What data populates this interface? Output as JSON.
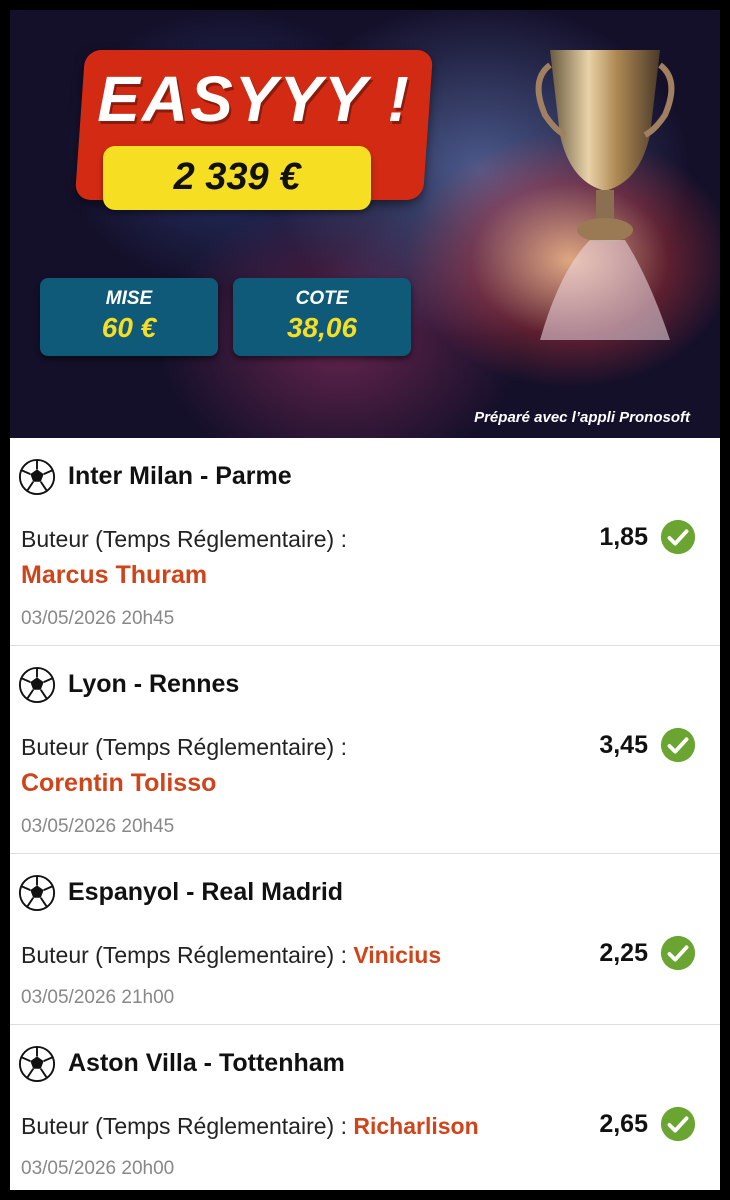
{
  "hero": {
    "headline": "EASYYY !",
    "amount": "2 339 €",
    "stake_label": "MISE",
    "stake_value": "60 €",
    "odds_label": "COTE",
    "odds_value": "38,06",
    "credit": "Préparé avec l’appli Pronosoft"
  },
  "bets": [
    {
      "match": "Inter Milan - Parme",
      "market": "Buteur (Temps Réglementaire) :",
      "player": "Marcus Thuram",
      "odds": "1,85",
      "date": "03/05/2026 20h45",
      "status": "won"
    },
    {
      "match": "Lyon - Rennes",
      "market": "Buteur (Temps Réglementaire) :",
      "player": "Corentin Tolisso",
      "odds": "3,45",
      "date": "03/05/2026 20h45",
      "status": "won"
    },
    {
      "match": "Espanyol - Real Madrid",
      "market": "Buteur (Temps Réglementaire) :",
      "player": "Vinicius",
      "odds": "2,25",
      "date": "03/05/2026 21h00",
      "status": "won"
    },
    {
      "match": "Aston Villa - Tottenham",
      "market": "Buteur (Temps Réglementaire) :",
      "player": "Richarlison",
      "odds": "2,65",
      "date": "03/05/2026 20h00",
      "status": "won"
    }
  ],
  "icons": {
    "sport": "soccer-ball-icon",
    "status": "check-circle-icon"
  },
  "colors": {
    "banner": "#d32b13",
    "amount": "#f6de23",
    "stat_box": "#0f5a78",
    "player": "#d0441a",
    "check": "#6aa532"
  }
}
